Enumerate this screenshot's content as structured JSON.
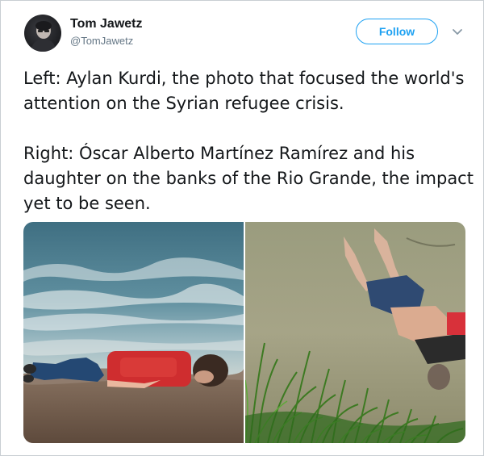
{
  "tweet": {
    "author": {
      "display_name": "Tom Jawetz",
      "handle": "@TomJawetz"
    },
    "follow_label": "Follow",
    "paragraphs": [
      "Left: Aylan Kurdi, the photo that focused the world's attention on the Syrian refugee crisis.",
      "Right: Óscar Alberto Martínez Ramírez and his daughter on the banks of the Rio Grande, the impact yet to be seen."
    ],
    "icons": {
      "more": "chevron-down-icon"
    },
    "colors": {
      "accent": "#1da1f2",
      "text": "#14171a",
      "secondary_text": "#657786"
    }
  }
}
